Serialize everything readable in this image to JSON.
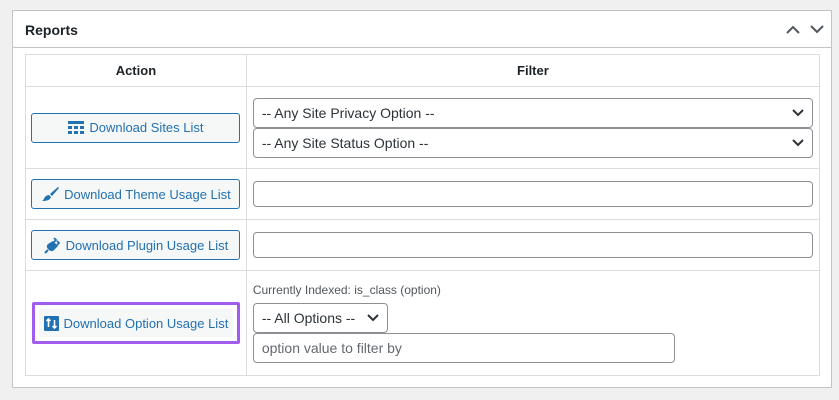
{
  "panel": {
    "title": "Reports",
    "collapse_up_icon": "chevron-up-icon",
    "collapse_down_icon": "chevron-down-icon"
  },
  "table": {
    "headers": {
      "action": "Action",
      "filter": "Filter"
    },
    "rows": [
      {
        "button_label": "Download Sites List",
        "button_icon": "table-grid-icon",
        "filters": {
          "privacy_select": "-- Any Site Privacy Option --",
          "status_select": "-- Any Site Status Option --"
        }
      },
      {
        "button_label": "Download Theme Usage List",
        "button_icon": "paintbrush-icon",
        "filters": {
          "text_value": ""
        }
      },
      {
        "button_label": "Download Plugin Usage List",
        "button_icon": "plugin-icon",
        "filters": {
          "text_value": ""
        }
      },
      {
        "button_label": "Download Option Usage List",
        "button_icon": "sort-arrows-icon",
        "focused": true,
        "filters": {
          "indexed_note": "Currently Indexed: is_class (option)",
          "options_select": "-- All Options --",
          "value_placeholder": "option value to filter by"
        }
      }
    ]
  },
  "colors": {
    "accent": "#2271b1",
    "focus_ring": "#a35dee",
    "border": "#c3c4c7",
    "background": "#f0f0f1"
  }
}
